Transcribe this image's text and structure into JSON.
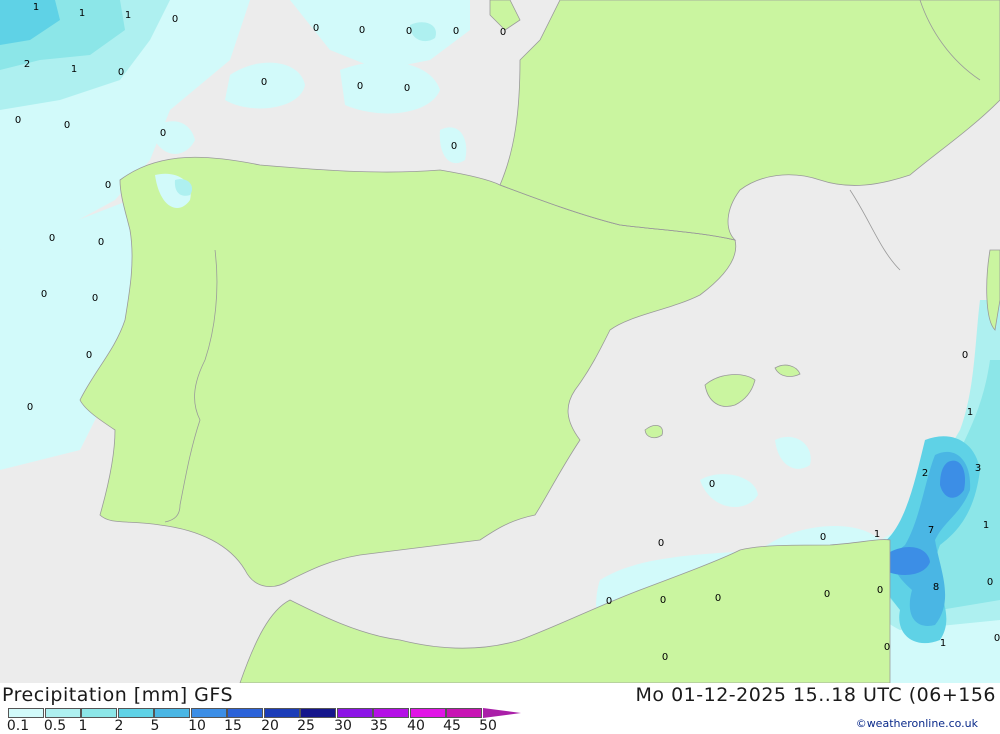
{
  "header": {
    "title": "Precipitation [mm] GFS",
    "datetime": "Mo 01-12-2025 15..18 UTC (06+156"
  },
  "credit": "©weatheronline.co.uk",
  "legend": {
    "labels": [
      "0.1",
      "0.5",
      "1",
      "2",
      "5",
      "10",
      "15",
      "20",
      "25",
      "30",
      "35",
      "40",
      "45",
      "50"
    ],
    "colors": [
      "#d2fafa",
      "#aef0f0",
      "#8ce6e8",
      "#5fd2e6",
      "#4ab6e4",
      "#3c8ee6",
      "#2b62d8",
      "#1b3cb8",
      "#15168c",
      "#8c14e6",
      "#b40fe6",
      "#e114e6",
      "#c814b4",
      "#aa1fa8"
    ]
  },
  "map": {
    "colors": {
      "sea": "#ececec",
      "land": "#caf5a0",
      "border": "#9a9a9a"
    },
    "values": [
      "1",
      "1",
      "1",
      "0",
      "2",
      "1",
      "0",
      "0",
      "0",
      "0",
      "0",
      "0",
      "0",
      "0",
      "0",
      "0",
      "0",
      "0",
      "0",
      "0",
      "0",
      "0",
      "0",
      "0",
      "0",
      "0",
      "0",
      "0",
      "0",
      "1",
      "2",
      "3",
      "1",
      "7",
      "1",
      "8",
      "0",
      "0",
      "0",
      "0",
      "0",
      "0",
      "0",
      "0",
      "1",
      "0",
      "0"
    ]
  }
}
